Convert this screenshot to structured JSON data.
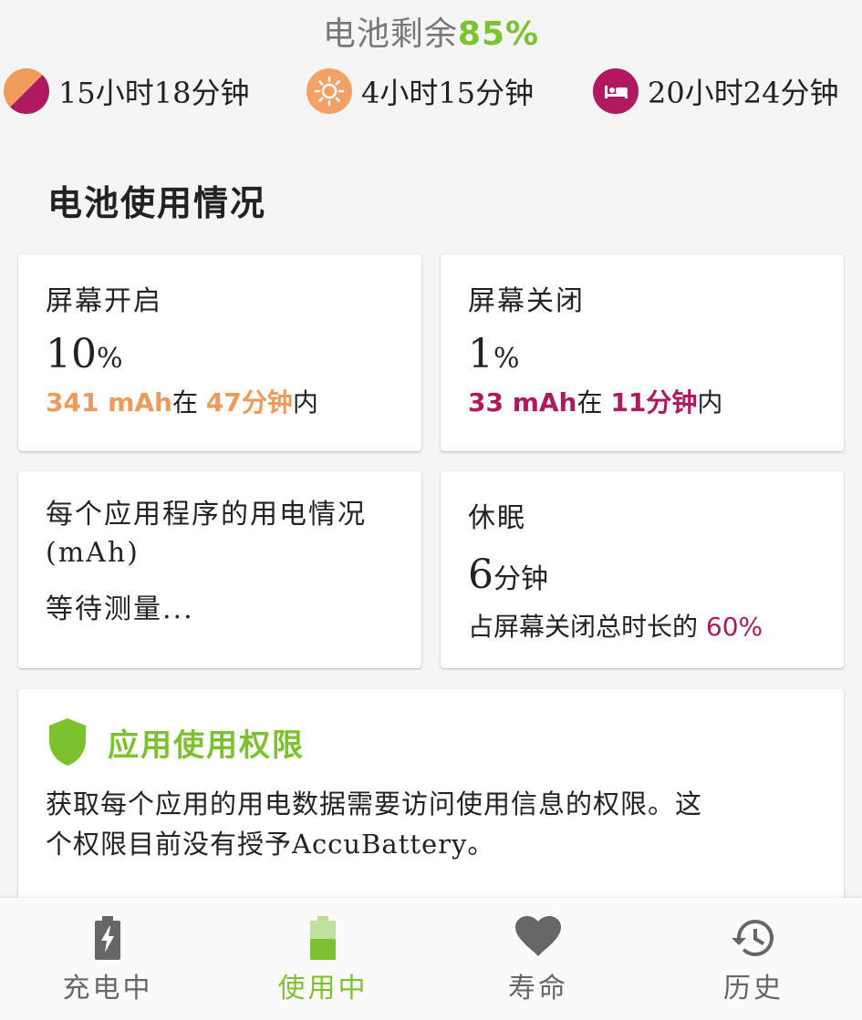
{
  "header": {
    "battery_prefix": "电池剩余",
    "battery_percent": "85%"
  },
  "estimates": [
    {
      "icon": "mixed-usage-icon",
      "value": "15小时18分钟"
    },
    {
      "icon": "sun-icon",
      "value": "4小时15分钟"
    },
    {
      "icon": "bed-icon",
      "value": "20小时24分钟"
    }
  ],
  "section": {
    "title": "电池使用情况"
  },
  "cards": {
    "screen_on": {
      "label": "屏幕开启",
      "percent": "10",
      "percent_unit": "%",
      "mah": "341 mAh",
      "in_text": "在 ",
      "duration": "47分钟",
      "suffix": "内"
    },
    "screen_off": {
      "label": "屏幕关闭",
      "percent": "1",
      "percent_unit": "%",
      "mah": "33 mAh",
      "in_text": "在 ",
      "duration": "11分钟",
      "suffix": "内"
    },
    "per_app": {
      "label": "每个应用程序的用电情况",
      "unit": "(mAh)",
      "status": "等待测量..."
    },
    "sleep": {
      "label": "休眠",
      "value": "6",
      "value_unit": "分钟",
      "detail_prefix": "占屏幕关闭总时长的 ",
      "detail_pct": "60%"
    }
  },
  "permission": {
    "icon": "shield-icon",
    "title": "应用使用权限",
    "body_line1": "获取每个应用的用电数据需要访问使用信息的权限。这",
    "body_line2": "个权限目前没有授予AccuBattery。"
  },
  "nav": [
    {
      "label": "充电中",
      "icon": "charging-battery-icon",
      "active": false
    },
    {
      "label": "使用中",
      "icon": "battery-icon",
      "active": true
    },
    {
      "label": "寿命",
      "icon": "heart-icon",
      "active": false
    },
    {
      "label": "历史",
      "icon": "history-icon",
      "active": false
    }
  ],
  "colors": {
    "accent": "#7cc230",
    "orange": "#ee9a5a",
    "magenta": "#ae1a5e"
  }
}
